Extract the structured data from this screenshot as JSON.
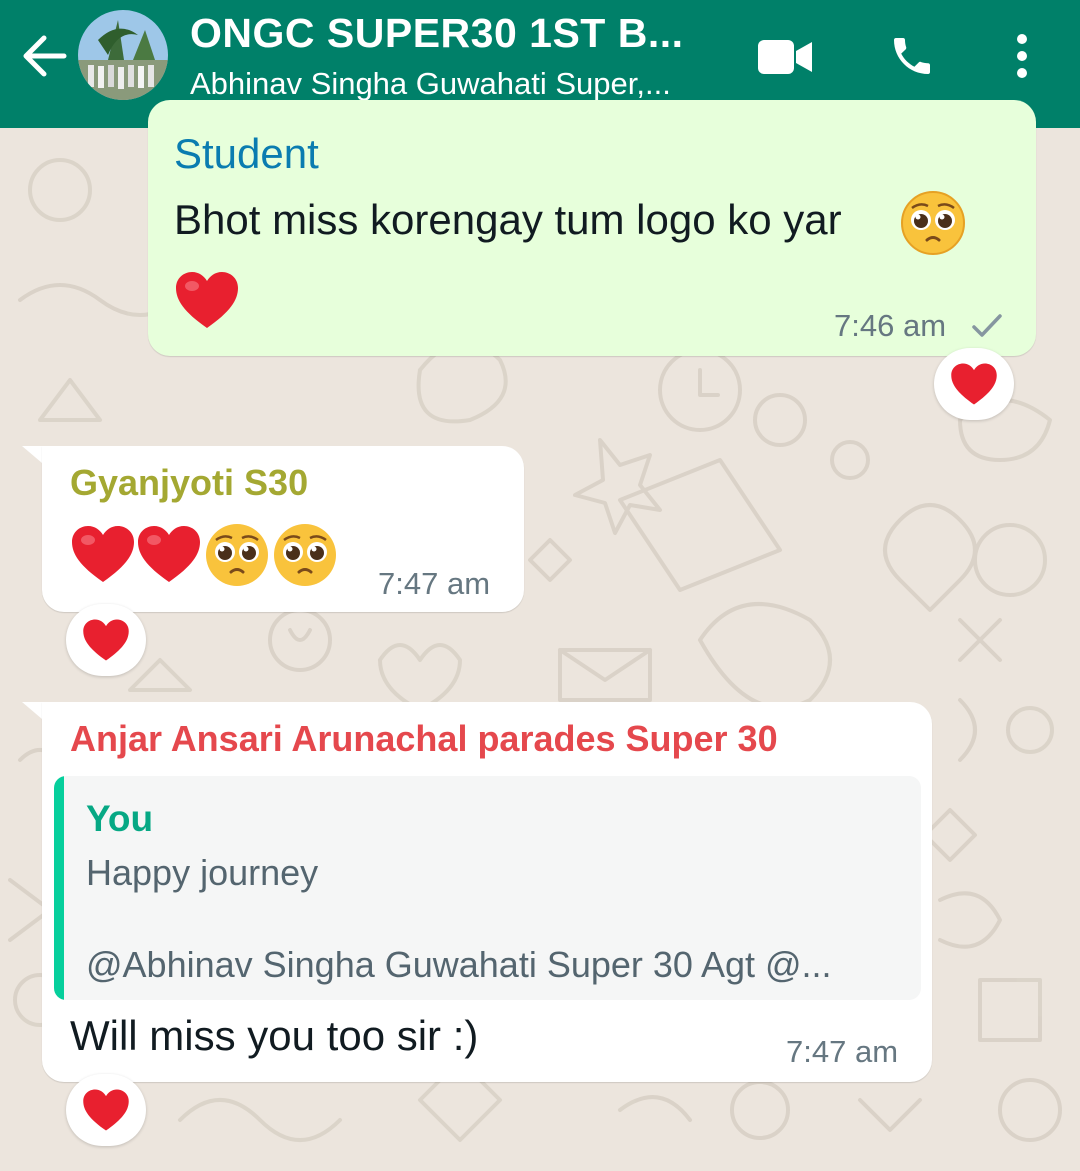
{
  "header": {
    "title": "ONGC SUPER30 1ST B...",
    "subtitle": "Abhinav Singha Guwahati Super,...",
    "color": "#008069"
  },
  "icons": {
    "back": "arrow-left-icon",
    "video": "video-camera-icon",
    "call": "phone-icon",
    "menu": "more-vertical-icon"
  },
  "messages": [
    {
      "direction": "outgoing",
      "sender": "Student",
      "text": "Bhot miss korengay tum logo ko yar",
      "emojis": [
        "pleading-face",
        "red-heart"
      ],
      "time": "7:46 am",
      "status": "sent-check",
      "reaction": "red-heart"
    },
    {
      "direction": "incoming",
      "sender": "Gyanjyoti S30",
      "sender_color": "#A4A832",
      "emojis": [
        "red-heart",
        "red-heart",
        "pleading-face",
        "pleading-face"
      ],
      "time": "7:47 am",
      "reaction": "red-heart"
    },
    {
      "direction": "incoming",
      "sender": "Anjar Ansari Arunachal parades Super 30",
      "sender_color": "#E5484D",
      "quote": {
        "author": "You",
        "text": "Happy journey",
        "mention": "@Abhinav Singha Guwahati Super 30 Agt @..."
      },
      "text": "Will miss you too sir :)",
      "time": "7:47 am",
      "reaction": "red-heart"
    }
  ]
}
